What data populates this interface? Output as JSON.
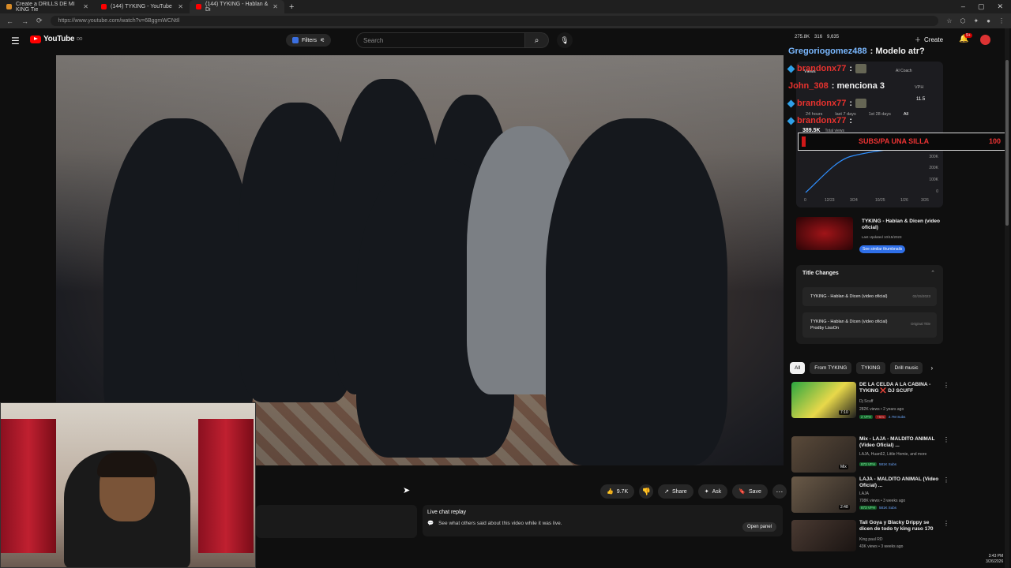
{
  "browser": {
    "tabs": [
      {
        "label": "Create a DRILLS DE MI KING Tie",
        "icon": "doc-icon"
      },
      {
        "label": "(144) TYKING - YouTube",
        "icon": "youtube-icon"
      },
      {
        "label": "(144) TYKING - Hablan & Di",
        "icon": "youtube-icon"
      }
    ],
    "url": "https://www.youtube.com/watch?v=6BggmWCNtIl",
    "new_tab": "+",
    "window_controls": [
      "–",
      "▢",
      "✕"
    ]
  },
  "youtube": {
    "logo": "YouTube",
    "logo_sup": "DO",
    "filters_label": "Filters",
    "search_placeholder": "Search",
    "create_label": "Create",
    "notif_count": "9+",
    "stats": [
      "275.8K",
      "316",
      "9,635"
    ]
  },
  "video_actions": {
    "like_count": "9.7K",
    "share_label": "Share",
    "ask_label": "Ask",
    "save_label": "Save"
  },
  "live_chat": {
    "title": "Live chat replay",
    "subtitle": "See what others said about this video while it was live.",
    "open_label": "Open panel"
  },
  "chat_overlay": [
    {
      "user": "Gregoriogomez488",
      "text": ": Modelo atr?"
    },
    {
      "user": "brandonx77",
      "text": ":"
    },
    {
      "user": "John_308",
      "text": ": menciona 3"
    },
    {
      "user": "brandonx77",
      "text": ":"
    },
    {
      "user": "brandonx77",
      "text": ":"
    }
  ],
  "vidiq": {
    "coach_label": "AI Coach",
    "views_label": "Views",
    "vph_label": "VPH",
    "vph_value": "11.5",
    "range_tabs": [
      "24 hours",
      "last 7 days",
      "1st 28 days",
      "All"
    ],
    "total_views": "389.5K",
    "total_views_label": "Total views",
    "y_ticks": [
      "300K",
      "200K",
      "100K",
      "0"
    ],
    "x_ticks": [
      "0",
      "12/23",
      "3/24",
      "10/25",
      "1/26",
      "3/26"
    ]
  },
  "subs_bar": {
    "label": "SUBS/PA UNA SILLA",
    "value": "100",
    "progress": 0.02
  },
  "video_card": {
    "title": "TYKING - Hablan & Dicen (video oficial)",
    "date": "Last Updated 10/15/2023",
    "button": "See similar thumbnails"
  },
  "title_changes": {
    "heading": "Title Changes",
    "items": [
      {
        "title": "TYKING - Hablan & Dicen (video oficial)",
        "date": "02/15/2023"
      },
      {
        "title": "TYKING - Hablan & Dicen (video oficial) Prodby LissOn",
        "date": "Original Title"
      }
    ]
  },
  "chips": [
    "All",
    "From TYKING",
    "TYKING",
    "Drill music"
  ],
  "recommendations": [
    {
      "title": "DE LA CELDA A LA CABINA - TYKING ❌ DJ SCUFF",
      "channel": "Dj Scuff",
      "meta": "282K views • 2 years ago",
      "duration": "7:10",
      "tags": [
        "2 VPH",
        "+60x",
        "2.7M Subs"
      ]
    },
    {
      "title": "Mix - LAJA - MALDITO ANIMAL (Video Oficial) ...",
      "channel": "LAJA, Huan62, Little Homie, and more",
      "meta": "",
      "duration": "Mix",
      "tags": [
        "873 VPH",
        "",
        "581K Subs"
      ]
    },
    {
      "title": "LAJA - MALDITO ANIMAL (Video Oficial) ...",
      "channel": "LAJA",
      "meta": "708K views • 3 weeks ago",
      "duration": "2:48",
      "tags": [
        "873 VPH",
        "",
        "581K Subs"
      ]
    },
    {
      "title": "Tali Goya y Blacky Drippy se dicen de todo ty king ruso 170",
      "channel": "King paul RD",
      "meta": "43K views • 3 weeks ago",
      "duration": "",
      "tags": []
    }
  ],
  "clock": {
    "time": "3:43 PM",
    "date": "3/26/2026"
  }
}
